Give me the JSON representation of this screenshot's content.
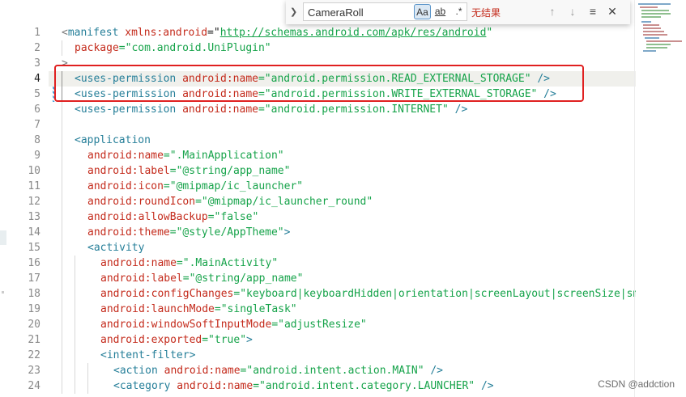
{
  "find_widget": {
    "query": "CameraRoll",
    "match_case_label": "Aa",
    "whole_word_label": "ab",
    "regex_label": ".*",
    "result_text": "无结果",
    "prev_icon": "arrow-up-icon",
    "next_icon": "arrow-down-icon",
    "selection_icon": "lines-icon",
    "close_icon": "close-icon"
  },
  "colors": {
    "tag": "#267f99",
    "attribute": "#c42b1c",
    "string": "#16a34a",
    "annotation_box": "#e02020"
  },
  "line_numbers": [
    "1",
    "2",
    "3",
    "4",
    "5",
    "6",
    "7",
    "8",
    "9",
    "10",
    "11",
    "12",
    "13",
    "14",
    "15",
    "16",
    "17",
    "18",
    "19",
    "20",
    "21",
    "22",
    "23",
    "24"
  ],
  "code": {
    "l1_open": "<",
    "l1_tag": "manifest",
    "l1_attr": "xmlns:android",
    "l1_eq": "=\"",
    "l1_url": "http://schemas.android.com/apk/res/android",
    "l1_q": "\"",
    "l2_attr": "package",
    "l2_str": "=\"com.android.UniPlugin\"",
    "l3_text": ">",
    "l4_tag": "<uses-permission",
    "l4_attr": "android:name",
    "l4_str": "=\"android.permission.READ_EXTERNAL_STORAGE\"",
    "l4_end": " />",
    "l5_tag": "<uses-permission",
    "l5_attr": "android:name",
    "l5_str": "=\"android.permission.WRITE_EXTERNAL_STORAGE\"",
    "l5_end": " />",
    "l6_tag": "<uses-permission",
    "l6_attr": "android:name",
    "l6_str": "=\"android.permission.INTERNET\"",
    "l6_end": " />",
    "l8_tag": "<application",
    "l9_attr": "android:name",
    "l9_str": "=\".MainApplication\"",
    "l10_attr": "android:label",
    "l10_str": "=\"@string/app_name\"",
    "l11_attr": "android:icon",
    "l11_str": "=\"@mipmap/ic_launcher\"",
    "l12_attr": "android:roundIcon",
    "l12_str": "=\"@mipmap/ic_launcher_round\"",
    "l13_attr": "android:allowBackup",
    "l13_str": "=\"false\"",
    "l14_attr": "android:theme",
    "l14_str": "=\"@style/AppTheme\"",
    "l14_end": ">",
    "l15_tag": "<activity",
    "l16_attr": "android:name",
    "l16_str": "=\".MainActivity\"",
    "l17_attr": "android:label",
    "l17_str": "=\"@string/app_name\"",
    "l18_attr": "android:configChanges",
    "l18_str": "=\"keyboard|keyboardHidden|orientation|screenLayout|screenSize|sma",
    "l19_attr": "android:launchMode",
    "l19_str": "=\"singleTask\"",
    "l20_attr": "android:windowSoftInputMode",
    "l20_str": "=\"adjustResize\"",
    "l21_attr": "android:exported",
    "l21_str": "=\"true\"",
    "l21_end": ">",
    "l22_tag": "<intent-filter",
    "l22_end": ">",
    "l23_tag": "<action",
    "l23_attr": "android:name",
    "l23_str": "=\"android.intent.action.MAIN\"",
    "l23_end": " />",
    "l24_tag": "<category",
    "l24_attr": "android:name",
    "l24_str": "=\"android.intent.category.LAUNCHER\"",
    "l24_end": " />"
  },
  "watermark": "CSDN @addction"
}
